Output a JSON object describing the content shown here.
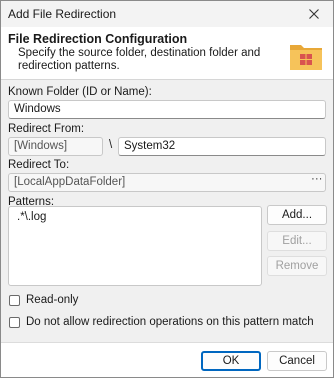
{
  "window": {
    "title": "Add File Redirection",
    "close_icon": "close-icon"
  },
  "header": {
    "title": "File Redirection Configuration",
    "description": "Specify the source folder, destination folder and redirection patterns.",
    "icon": "folder-windows-icon"
  },
  "known_folder": {
    "label": "Known Folder (ID or Name):",
    "value": "Windows"
  },
  "redirect_from": {
    "label": "Redirect From:",
    "base": "[Windows]",
    "separator": "\\",
    "subpath": "System32"
  },
  "redirect_to": {
    "label": "Redirect To:",
    "value": "[LocalAppDataFolder]",
    "browse_label": "···"
  },
  "patterns": {
    "label": "Patterns:",
    "items": [
      ".*\\.log"
    ],
    "add_label": "Add...",
    "edit_label": "Edit...",
    "remove_label": "Remove"
  },
  "options": {
    "read_only_label": "Read-only",
    "read_only_checked": false,
    "no_redirect_label": "Do not allow redirection operations on this pattern match",
    "no_redirect_checked": false
  },
  "footer": {
    "ok_label": "OK",
    "cancel_label": "Cancel"
  },
  "colors": {
    "accent": "#0067c0",
    "folder": "#e8a838",
    "windows_logo": "#d9534f"
  }
}
